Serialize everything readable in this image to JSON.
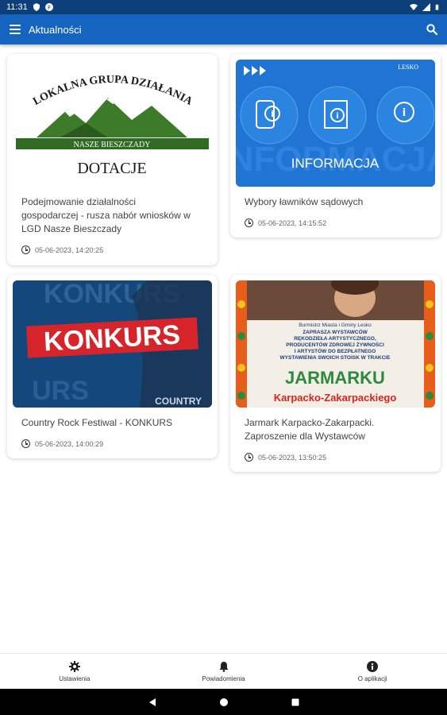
{
  "status_bar": {
    "time": "11:31"
  },
  "app_bar": {
    "title": "Aktualności"
  },
  "cards": [
    {
      "image_text": {
        "arc": "LOKALNA GRUPA DZIAŁANIA",
        "banner": "NASZE BIESZCZADY",
        "bottom": "DOTACJE"
      },
      "title_lines": [
        "Podejmowanie działalności",
        "gospodarczej - rusza nabór wniosków w",
        "LGD Nasze Bieszczady"
      ],
      "date": "05-06-2023, 14:20:25"
    },
    {
      "image_text": {
        "logo": "LESKO",
        "main": "INFORMACJA"
      },
      "title_lines": [
        "Wybory ławników sądowych"
      ],
      "date": "05-06-2023, 14:15:52"
    },
    {
      "image_text": {
        "main": "KONKURS",
        "corner": "COUNTRY"
      },
      "title_lines": [
        "Country Rock Festiwal - KONKURS"
      ],
      "date": "05-06-2023, 14:00:29"
    },
    {
      "image_text": {
        "line1": "Burmistrz Miasta i Gminy Lesko",
        "line2": "ZAPRASZA WYSTAWCÓW",
        "line3": "RĘKODZIEŁA ARTYSTYCZNEGO,",
        "line4": "PRODUCENTÓW ZDROWEJ ŻYWNOŚCI",
        "line5": "I ARTYSTÓW DO BEZPŁATNEGO",
        "line6": "WYSTAWIENIA SWOICH STOISK W TRAKCIE",
        "big": "JARMARKU",
        "sub": "Karpacko-Zakarpackiego"
      },
      "title_lines": [
        "Jarmark Karpacko-Zakarpacki.",
        "Zaproszenie dla Wystawców"
      ],
      "date": "05-06-2023, 13:50:25"
    }
  ],
  "bottom_nav": [
    {
      "label": "Ustawienia",
      "icon": "gear-icon"
    },
    {
      "label": "Powiadomienia",
      "icon": "bell-icon"
    },
    {
      "label": "O aplikacji",
      "icon": "info-icon"
    }
  ],
  "colors": {
    "app_bar": "#1565c0",
    "status_bar": "#0d3f7a"
  }
}
